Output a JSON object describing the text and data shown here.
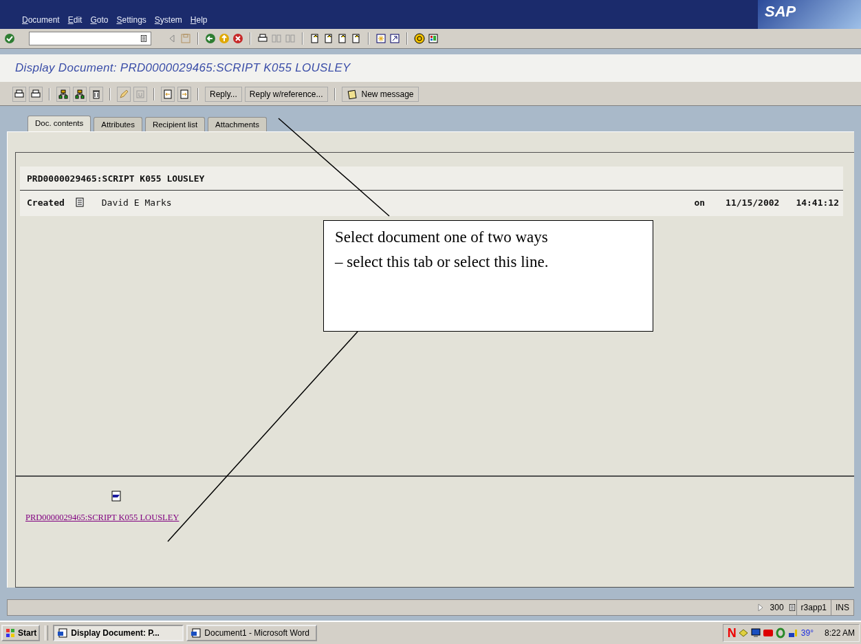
{
  "menu_bar": {
    "items": [
      "Document",
      "Edit",
      "Goto",
      "Settings",
      "System",
      "Help"
    ]
  },
  "logo": "SAP",
  "title": "Display Document: PRD0000029465:SCRIPT K055 LOUSLEY",
  "app_toolbar": {
    "buttons": [
      "Reply...",
      "Reply w/reference..."
    ],
    "new_message": "New message"
  },
  "tabs": [
    {
      "label": "Doc. contents",
      "selected": true
    },
    {
      "label": "Attributes",
      "selected": false
    },
    {
      "label": "Recipient list",
      "selected": false
    },
    {
      "label": "Attachments",
      "selected": false
    }
  ],
  "document": {
    "header_title": "PRD0000029465:SCRIPT K055 LOUSLEY",
    "created_label": "Created",
    "author": "David E Marks",
    "on_label": "on",
    "date": "11/15/2002",
    "time": "14:41:12"
  },
  "attachment": {
    "link": "PRD0000029465:SCRIPT K055 LOUSLEY"
  },
  "callout": {
    "lines": [
      "Select document one of two ways",
      "– select this tab or select this line."
    ]
  },
  "status_bar": {
    "client": "300",
    "server": "r3app1",
    "mode": "INS"
  },
  "taskbar": {
    "start": "Start",
    "tasks": [
      {
        "label": "Display Document: P...",
        "selected": true
      },
      {
        "label": "Document1 - Microsoft Word",
        "selected": false
      }
    ],
    "tray_letter": "N",
    "temperature": "39°",
    "clock": "8:22 AM"
  }
}
